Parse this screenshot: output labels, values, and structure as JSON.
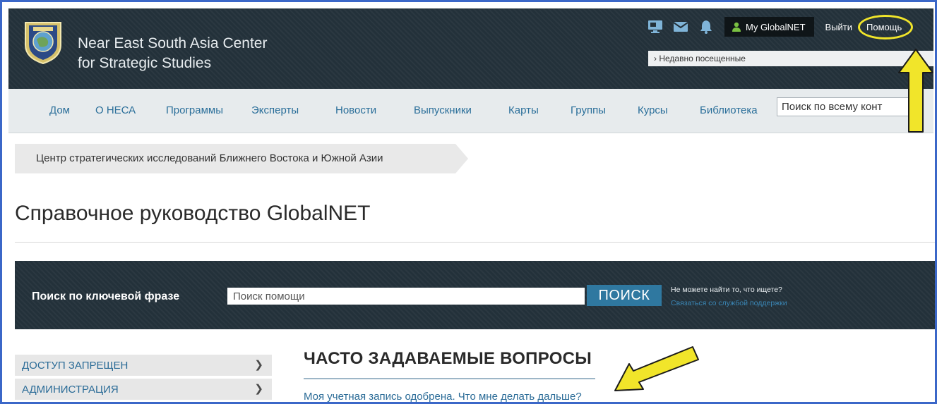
{
  "header": {
    "org_line1": "Near East South Asia Center",
    "org_line2": "for Strategic Studies",
    "icons": [
      "monitor-icon",
      "mail-icon",
      "bell-icon",
      "user-icon"
    ],
    "my_globalnet": "My GlobalNET",
    "logout": "Выйти",
    "help": "Помощь",
    "recently_visited": "Недавно посещенные"
  },
  "nav": {
    "items": [
      {
        "label": "Дом"
      },
      {
        "label": "О НЕСА"
      },
      {
        "label": "Программы"
      },
      {
        "label": "Эксперты"
      },
      {
        "label": "Новости"
      },
      {
        "label": "Выпускники"
      },
      {
        "label": "Карты"
      },
      {
        "label": "Группы"
      },
      {
        "label": "Курсы"
      },
      {
        "label": "Библиотека"
      }
    ],
    "search_value": "Поиск по всему конт"
  },
  "breadcrumb": "Центр стратегических исследований Ближнего Востока и Южной Азии",
  "page_title": "Справочное руководство GlobalNET",
  "help_search": {
    "label": "Поиск по ключевой фразе",
    "value": "Поиск помощи",
    "button": "ПОИСК",
    "note": "Не можете найти то, что ищете?",
    "contact_link": "Связаться со службой поддержки"
  },
  "sidebar": {
    "items": [
      {
        "label": "ДОСТУП ЗАПРЕЩЕН"
      },
      {
        "label": "АДМИНИСТРАЦИЯ"
      }
    ]
  },
  "faq": {
    "title": "ЧАСТО ЗАДАВАЕМЫЕ ВОПРОСЫ",
    "questions": [
      {
        "text": "Моя учетная запись одобрена. Что мне делать дальше?"
      }
    ]
  },
  "colors": {
    "frame_border": "#3b67c8",
    "header_bg": "#23313a",
    "link": "#2a6b97",
    "search_button": "#2f78a0",
    "annotation_yellow": "#f1e52a"
  }
}
